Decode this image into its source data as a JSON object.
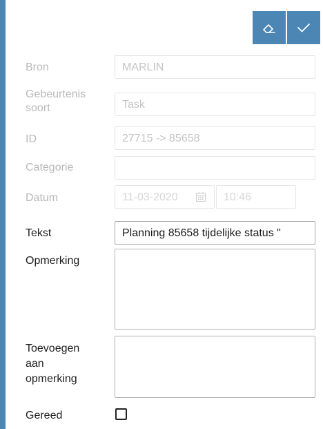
{
  "toolbar": {
    "clear_icon": "eraser-icon",
    "confirm_icon": "check-icon",
    "accent_color": "#4b86b4"
  },
  "form": {
    "bron": {
      "label": "Bron",
      "value": "MARLIN"
    },
    "gebeurtenis_soort": {
      "label_line1": "Gebeurtenis",
      "label_line2": "soort",
      "value": "Task"
    },
    "id": {
      "label": "ID",
      "value": "27715 -> 85658"
    },
    "categorie": {
      "label": "Categorie",
      "value": ""
    },
    "datum": {
      "label": "Datum",
      "date": "11-03-2020",
      "time": "10:46",
      "calendar_icon": "calendar-icon"
    },
    "tekst": {
      "label": "Tekst",
      "value": "Planning 85658 tijdelijke status \""
    },
    "opmerking": {
      "label": "Opmerking",
      "value": ""
    },
    "toevoegen": {
      "label_line1": "Toevoegen",
      "label_line2": "aan",
      "label_line3": "opmerking",
      "value": ""
    },
    "gereed": {
      "label": "Gereed",
      "checked": false
    }
  }
}
